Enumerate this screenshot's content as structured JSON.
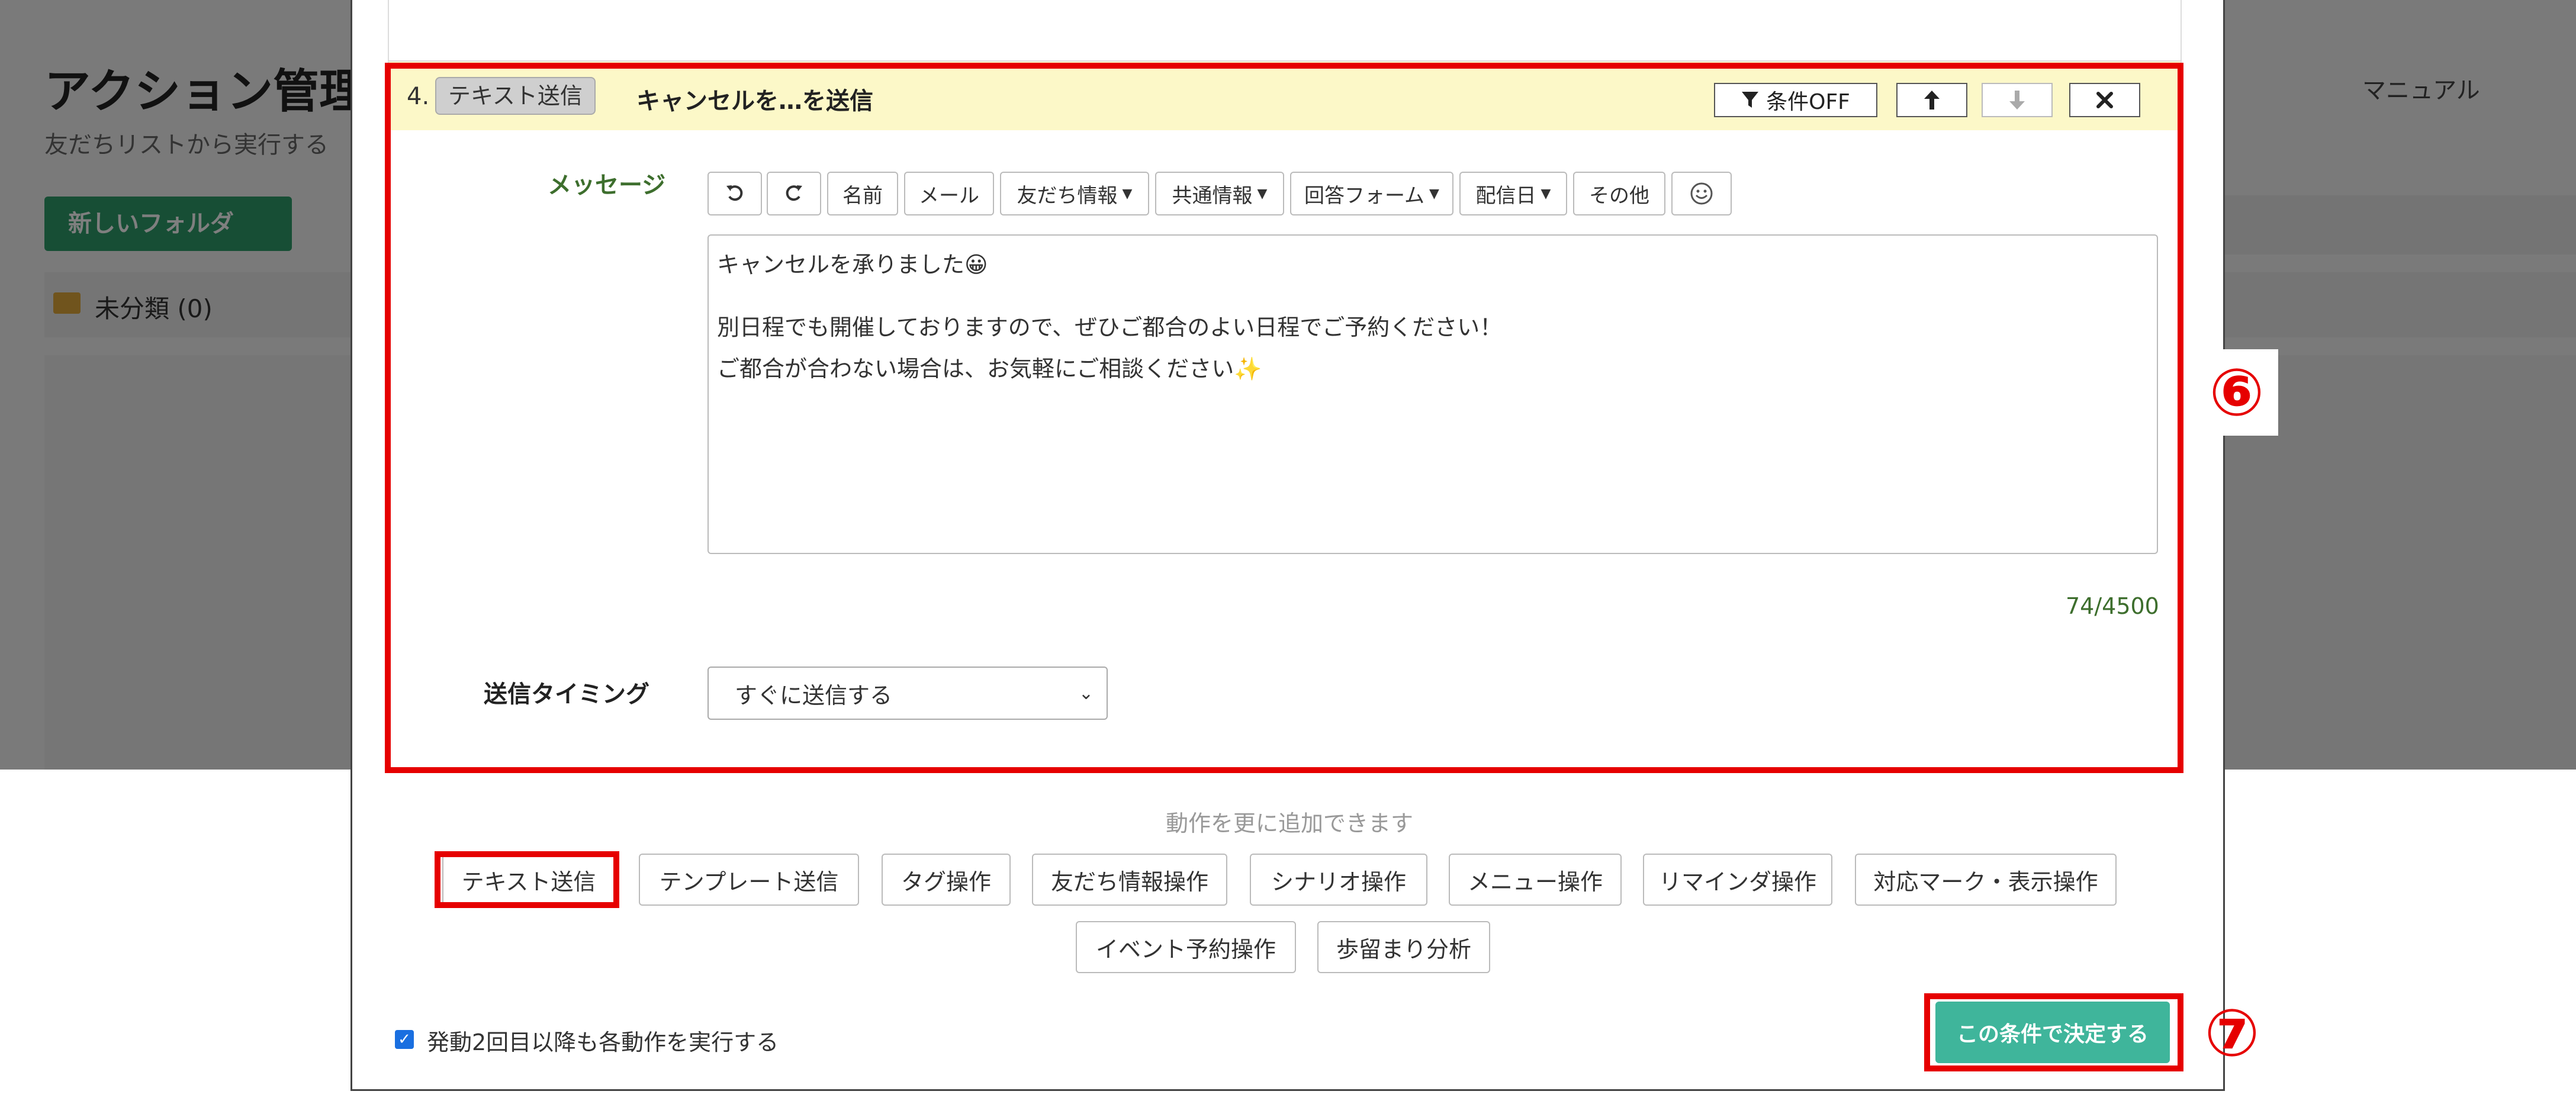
{
  "background_page": {
    "title": "アクション管理",
    "subtitle": "友だちリストから実行する",
    "manual_label": "マニュアル",
    "new_button_label": "新しいフォルダ",
    "folder_label": "未分類 (0)"
  },
  "action_block": {
    "number": "4.",
    "type_badge": "テキスト送信",
    "title": "キャンセルを…を送信",
    "condition_off_label": "条件OFF",
    "message_label": "メッセージ",
    "toolbar": {
      "name": "名前",
      "mail": "メール",
      "friend_info": "友だち情報",
      "common_info": "共通情報",
      "answer_form": "回答フォーム",
      "delivery_date": "配信日",
      "other": "その他"
    },
    "message_lines": [
      "キャンセルを承りました😀",
      "",
      "別日程でも開催しておりますので、ぜひご都合のよい日程でご予約ください！",
      "ご都合が合わない場合は、お気軽にご相談ください✨"
    ],
    "char_counter": "74/4500",
    "timing_label": "送信タイミング",
    "timing_value": "すぐに送信する"
  },
  "add_actions": {
    "hint": "動作を更に追加できます",
    "buttons": [
      "テキスト送信",
      "テンプレート送信",
      "タグ操作",
      "友だち情報操作",
      "シナリオ操作",
      "メニュー操作",
      "リマインダ操作",
      "対応マーク・表示操作",
      "イベント予約操作",
      "歩留まり分析"
    ]
  },
  "footer": {
    "repeat_checkbox_label": "発動2回目以降も各動作を実行する",
    "repeat_checked": true,
    "submit_label": "この条件で決定する"
  },
  "annotations": {
    "step_6": "⑥",
    "step_7": "⑦"
  },
  "colors": {
    "accent_green": "#3fb59b",
    "highlight_red": "#e60000",
    "header_yellow": "#fcf8c8",
    "label_green": "#3d6e2d"
  }
}
